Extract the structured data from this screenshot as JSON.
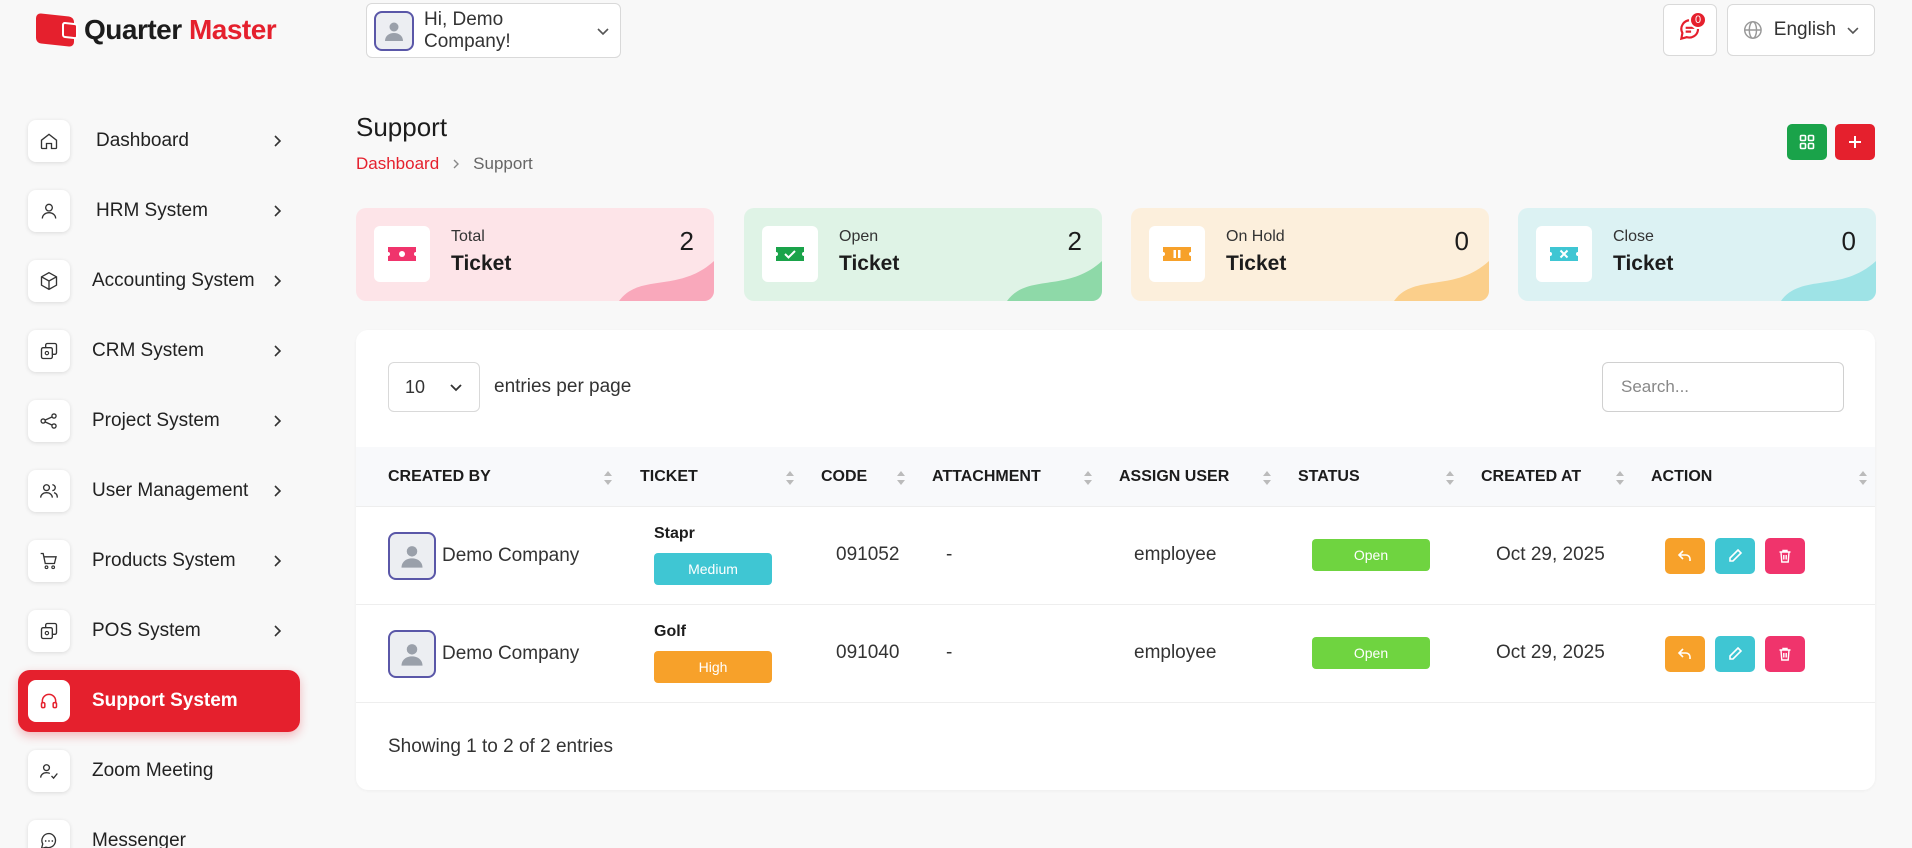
{
  "brand": {
    "name_part1": "Quarter",
    "name_part2": "Master"
  },
  "header": {
    "greeting": "Hi, Demo Company!",
    "notification_count": "0",
    "language": "English"
  },
  "sidebar": {
    "items": [
      {
        "label": "Dashboard",
        "icon": "home-icon"
      },
      {
        "label": "HRM System",
        "icon": "user-icon"
      },
      {
        "label": "Accounting System",
        "icon": "box-icon"
      },
      {
        "label": "CRM System",
        "icon": "layers-icon"
      },
      {
        "label": "Project System",
        "icon": "share-icon"
      },
      {
        "label": "User Management",
        "icon": "users-icon"
      },
      {
        "label": "Products System",
        "icon": "cart-icon"
      },
      {
        "label": "POS System",
        "icon": "layers-icon"
      },
      {
        "label": "Support System",
        "icon": "headphones-icon",
        "active": true
      },
      {
        "label": "Zoom Meeting",
        "icon": "user-check-icon"
      },
      {
        "label": "Messenger",
        "icon": "message-icon"
      }
    ]
  },
  "page": {
    "title": "Support",
    "breadcrumb": {
      "home": "Dashboard",
      "current": "Support"
    }
  },
  "stats": [
    {
      "label": "Total",
      "sub": "Ticket",
      "value": "2",
      "bg": "#fde4e8",
      "wave": "#f9a8bb",
      "icon_color": "#f0346c"
    },
    {
      "label": "Open",
      "sub": "Ticket",
      "value": "2",
      "bg": "#dff3e6",
      "wave": "#8ed9a8",
      "icon_color": "#1aa34a"
    },
    {
      "label": "On Hold",
      "sub": "Ticket",
      "value": "0",
      "bg": "#fcefdc",
      "wave": "#fbcf8b",
      "icon_color": "#f7a12a"
    },
    {
      "label": "Close",
      "sub": "Ticket",
      "value": "0",
      "bg": "#dcf2f3",
      "wave": "#9ee3e6",
      "icon_color": "#3fc6d3"
    }
  ],
  "table": {
    "per_page": "10",
    "per_page_label": "entries per page",
    "search_placeholder": "Search...",
    "columns": [
      "CREATED BY",
      "TICKET",
      "CODE",
      "ATTACHMENT",
      "ASSIGN USER",
      "STATUS",
      "CREATED AT",
      "ACTION"
    ],
    "rows": [
      {
        "created_by": "Demo Company",
        "ticket": "Stapr",
        "priority": "Medium",
        "priority_color": "#3fc6d3",
        "code": "091052",
        "attachment": "-",
        "assign_user": "employee",
        "status": "Open",
        "created_at": "Oct 29, 2025"
      },
      {
        "created_by": "Demo Company",
        "ticket": "Golf",
        "priority": "High",
        "priority_color": "#f7a12a",
        "code": "091040",
        "attachment": "-",
        "assign_user": "employee",
        "status": "Open",
        "created_at": "Oct 29, 2025"
      }
    ],
    "footer": "Showing 1 to 2 of 2 entries"
  }
}
